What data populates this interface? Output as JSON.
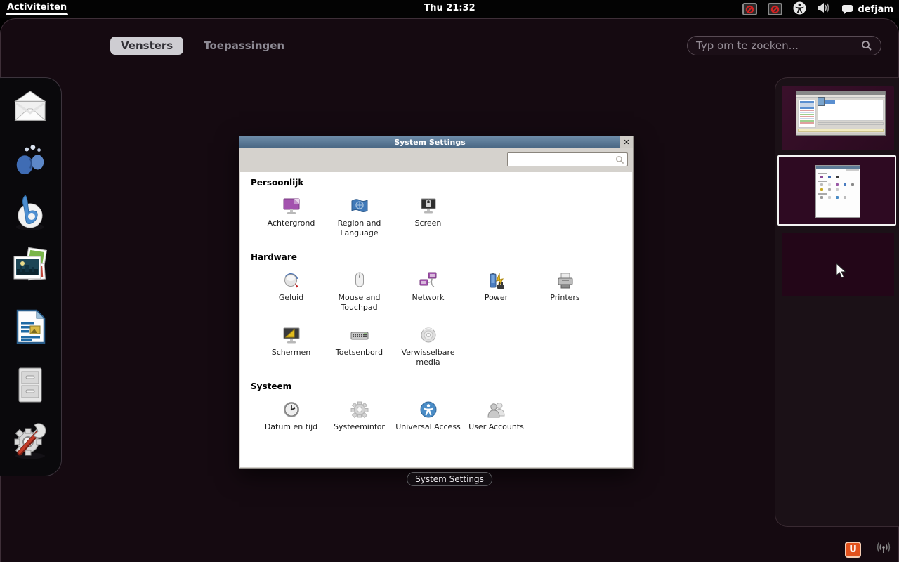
{
  "top_bar": {
    "activities_label": "Activiteiten",
    "clock": "Thu 21:32",
    "username": "defjam",
    "icons": [
      "record-blocked-icon",
      "record-blocked-icon",
      "accessibility-icon",
      "volume-icon",
      "chat-bubble-icon"
    ]
  },
  "overview": {
    "tabs": [
      {
        "label": "Vensters",
        "active": true
      },
      {
        "label": "Toepassingen",
        "active": false
      }
    ],
    "search_placeholder": "Typ om te zoeken...",
    "window_caption": "System Settings"
  },
  "dash": {
    "items": [
      "mail-client",
      "empathy-chat",
      "banshee-media-player",
      "shotwell-photos",
      "libreoffice-writer",
      "file-manager",
      "system-tools"
    ]
  },
  "settings_window": {
    "title": "System Settings",
    "close_glyph": "✕",
    "search_value": "",
    "sections": [
      {
        "title": "Persoonlijk",
        "items": [
          {
            "label": "Achtergrond",
            "icon": "background-icon"
          },
          {
            "label": "Region and Language",
            "icon": "region-language-icon"
          },
          {
            "label": "Screen",
            "icon": "screen-lock-icon"
          }
        ]
      },
      {
        "title": "Hardware",
        "items": [
          {
            "label": "Geluid",
            "icon": "sound-icon"
          },
          {
            "label": "Mouse and Touchpad",
            "icon": "mouse-icon"
          },
          {
            "label": "Network",
            "icon": "network-icon"
          },
          {
            "label": "Power",
            "icon": "power-icon"
          },
          {
            "label": "Printers",
            "icon": "printer-icon"
          },
          {
            "label": "Schermen",
            "icon": "displays-icon"
          },
          {
            "label": "Toetsenbord",
            "icon": "keyboard-icon"
          },
          {
            "label": "Verwisselbare media",
            "icon": "removable-media-icon"
          }
        ]
      },
      {
        "title": "Systeem",
        "items": [
          {
            "label": "Datum en tijd",
            "icon": "date-time-icon"
          },
          {
            "label": "Systeeminfor",
            "icon": "system-info-icon"
          },
          {
            "label": "Universal Access",
            "icon": "universal-access-icon"
          },
          {
            "label": "User Accounts",
            "icon": "user-accounts-icon"
          }
        ]
      }
    ]
  },
  "workspaces": {
    "thumbnails": [
      {
        "name": "workspace-1-media-player",
        "active": false
      },
      {
        "name": "workspace-2-system-settings",
        "active": true
      },
      {
        "name": "workspace-3-empty",
        "active": false
      }
    ]
  },
  "tray": {
    "ubuntu_one_glyph": "U"
  },
  "colors": {
    "titlebar": "#587a99",
    "ubuntu_orange": "#e2521d",
    "wallpaper_purple": "#2e0a22",
    "overview_bg": "#150a11"
  }
}
